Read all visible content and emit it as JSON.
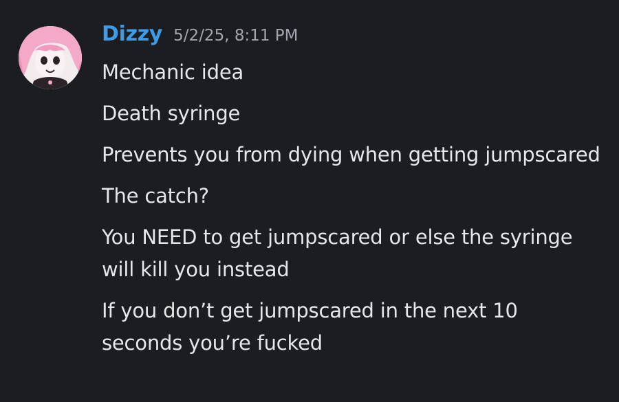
{
  "message": {
    "author": {
      "name": "Dizzy",
      "avatar_icon": "pink-haired-character-avatar",
      "name_color": "#3f9be6"
    },
    "timestamp": "5/2/25, 8:11 PM",
    "lines": [
      "Mechanic idea",
      "Death syringe",
      "Prevents you from dying when getting jumpscared",
      "The catch?",
      "You NEED to get jumpscared or else the syringe will kill you instead",
      "If you don’t get jumpscared in the next 10 seconds you’re fucked"
    ]
  }
}
